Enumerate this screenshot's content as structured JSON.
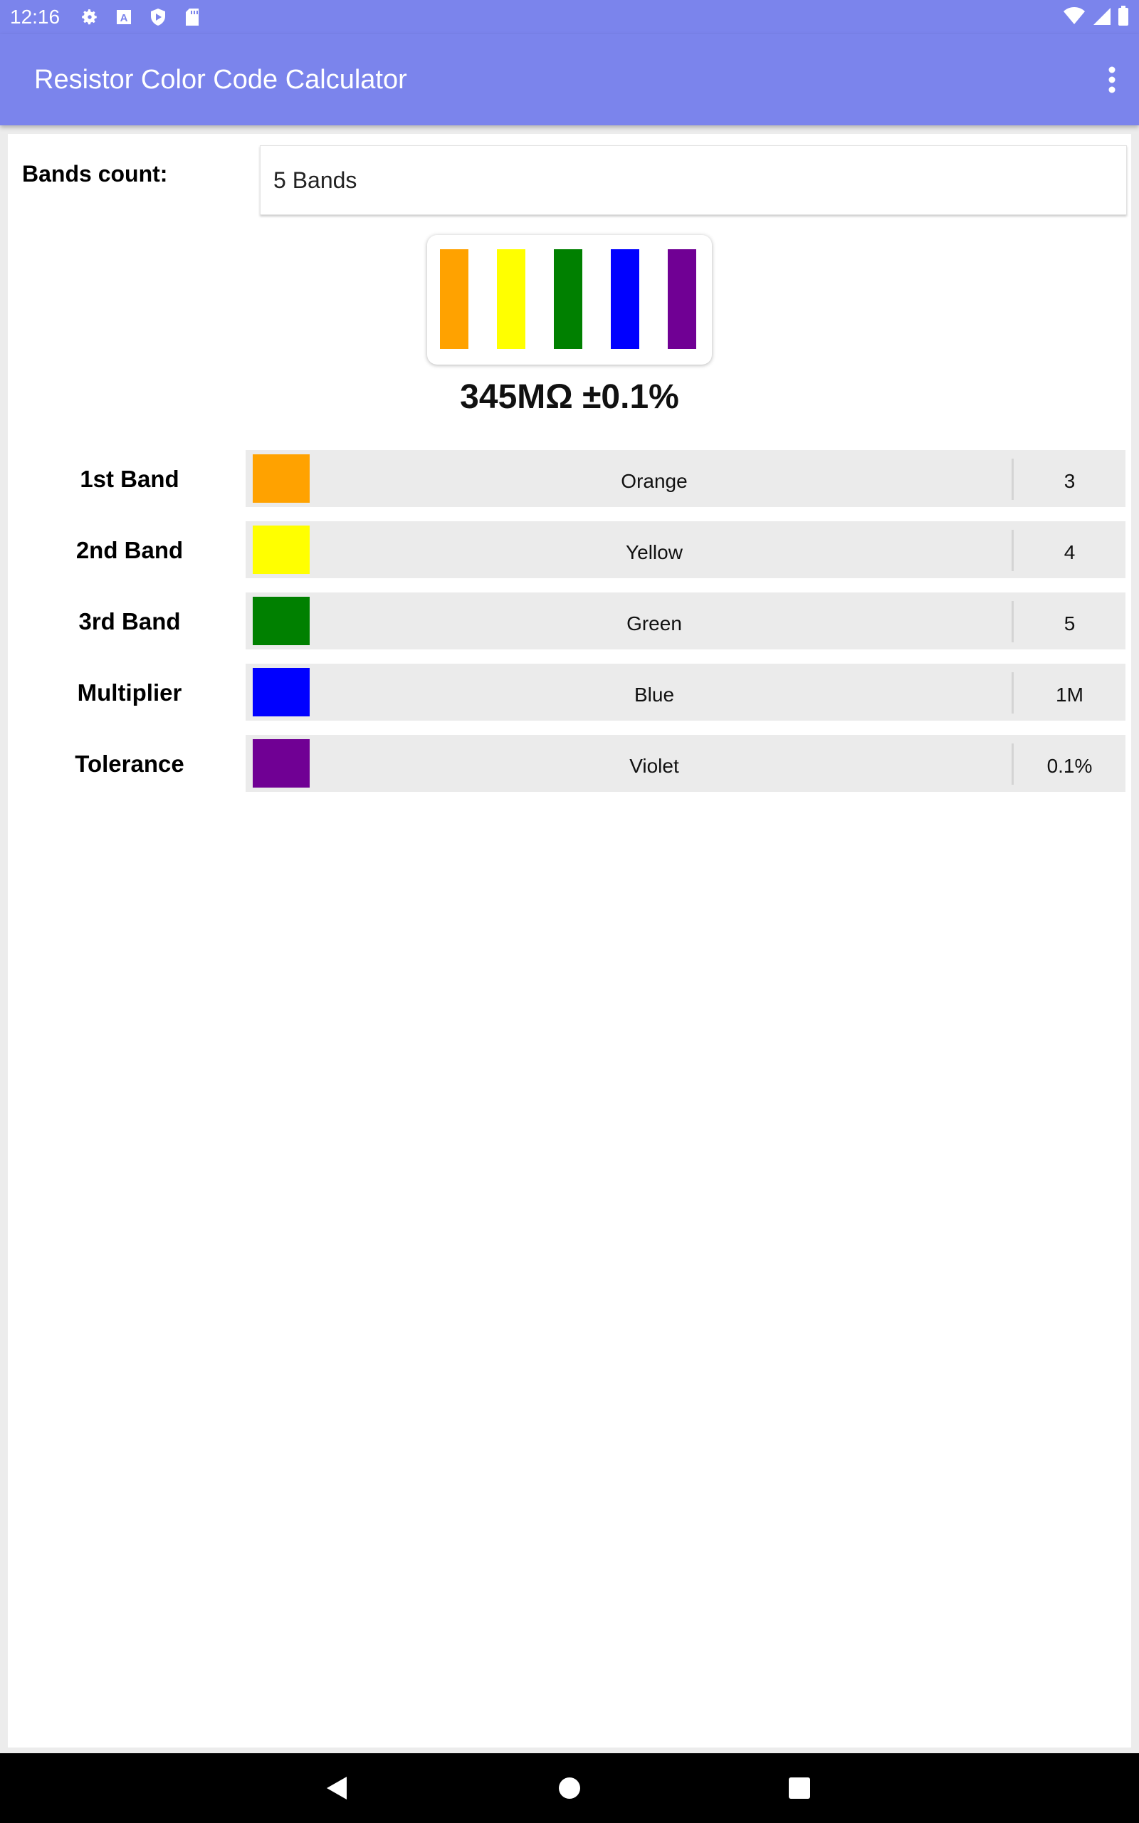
{
  "status_bar": {
    "time": "12:16",
    "icons": [
      "gear-icon",
      "a-icon",
      "shield-play-icon",
      "sd-card-icon"
    ],
    "right_icons": [
      "wifi-icon",
      "signal-icon",
      "battery-icon"
    ]
  },
  "app_bar": {
    "title": "Resistor Color Code Calculator",
    "color": "#7b84ec",
    "menu_icon": "more-vert-icon"
  },
  "bands_count": {
    "label": "Bands count:",
    "value": "5 Bands"
  },
  "resistor": {
    "band_colors": [
      "#ffa200",
      "#ffff00",
      "#008000",
      "#0000ff",
      "#700094"
    ]
  },
  "result": "345MΩ ±0.1%",
  "bands": [
    {
      "label": "1st Band",
      "color_name": "Orange",
      "color": "#ffa200",
      "value": "3"
    },
    {
      "label": "2nd Band",
      "color_name": "Yellow",
      "color": "#ffff00",
      "value": "4"
    },
    {
      "label": "3rd Band",
      "color_name": "Green",
      "color": "#008000",
      "value": "5"
    },
    {
      "label": "Multiplier",
      "color_name": "Blue",
      "color": "#0000ff",
      "value": "1M"
    },
    {
      "label": "Tolerance",
      "color_name": "Violet",
      "color": "#700094",
      "value": "0.1%"
    }
  ],
  "nav_bar": {
    "buttons": [
      "back-icon",
      "home-icon",
      "recents-icon"
    ]
  }
}
